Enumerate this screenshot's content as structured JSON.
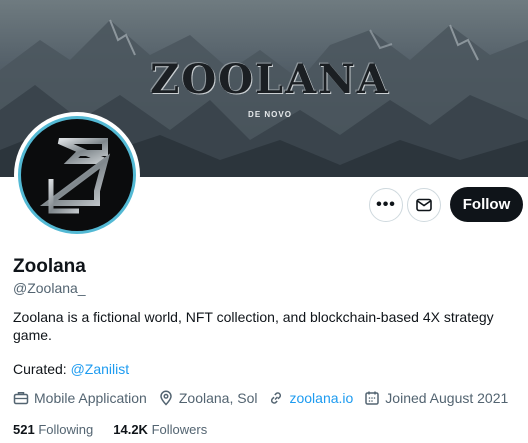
{
  "banner": {
    "title": "ZOOLANA",
    "subtitle": "DE NOVO"
  },
  "actions": {
    "more_label": "•••",
    "follow_label": "Follow"
  },
  "profile": {
    "name": "Zoolana",
    "handle": "@Zoolana_",
    "bio": "Zoolana is a fictional world, NFT collection, and blockchain-based 4X strategy game.",
    "curated_prefix": "Curated: ",
    "curated_link": "@Zanilist",
    "category": "Mobile Application",
    "location": "Zoolana, Sol",
    "website": "zoolana.io",
    "joined": "Joined August 2021"
  },
  "stats": {
    "following_count": "521",
    "following_label": "Following",
    "followers_count": "14.2K",
    "followers_label": "Followers"
  },
  "colors": {
    "link": "#1d9bf0",
    "avatar_ring": "#53b9d4"
  }
}
